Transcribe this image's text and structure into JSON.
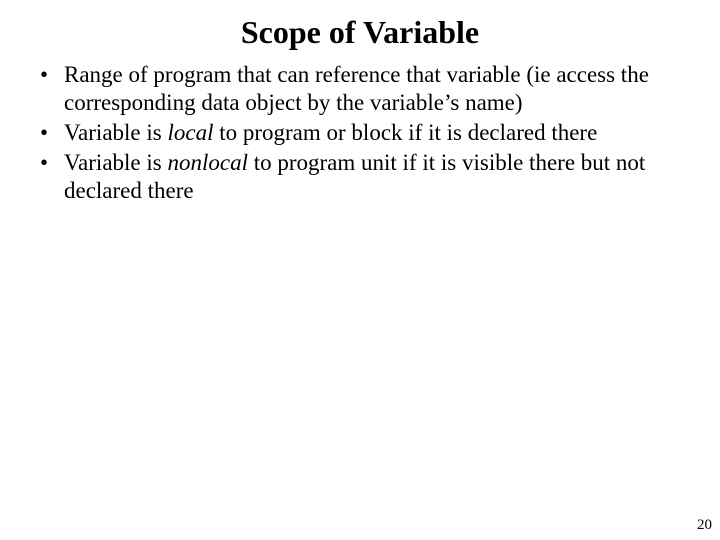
{
  "title": "Scope of Variable",
  "bullets": [
    {
      "before": "Range of program that can reference that variable (ie access the corresponding data object by the variable’s name)",
      "italic": "",
      "after": ""
    },
    {
      "before": "Variable is ",
      "italic": "local",
      "after": " to program or block if it is declared there"
    },
    {
      "before": "Variable is ",
      "italic": "nonlocal",
      "after": " to program unit if it is visible there but not declared there"
    }
  ],
  "page_number": "20"
}
